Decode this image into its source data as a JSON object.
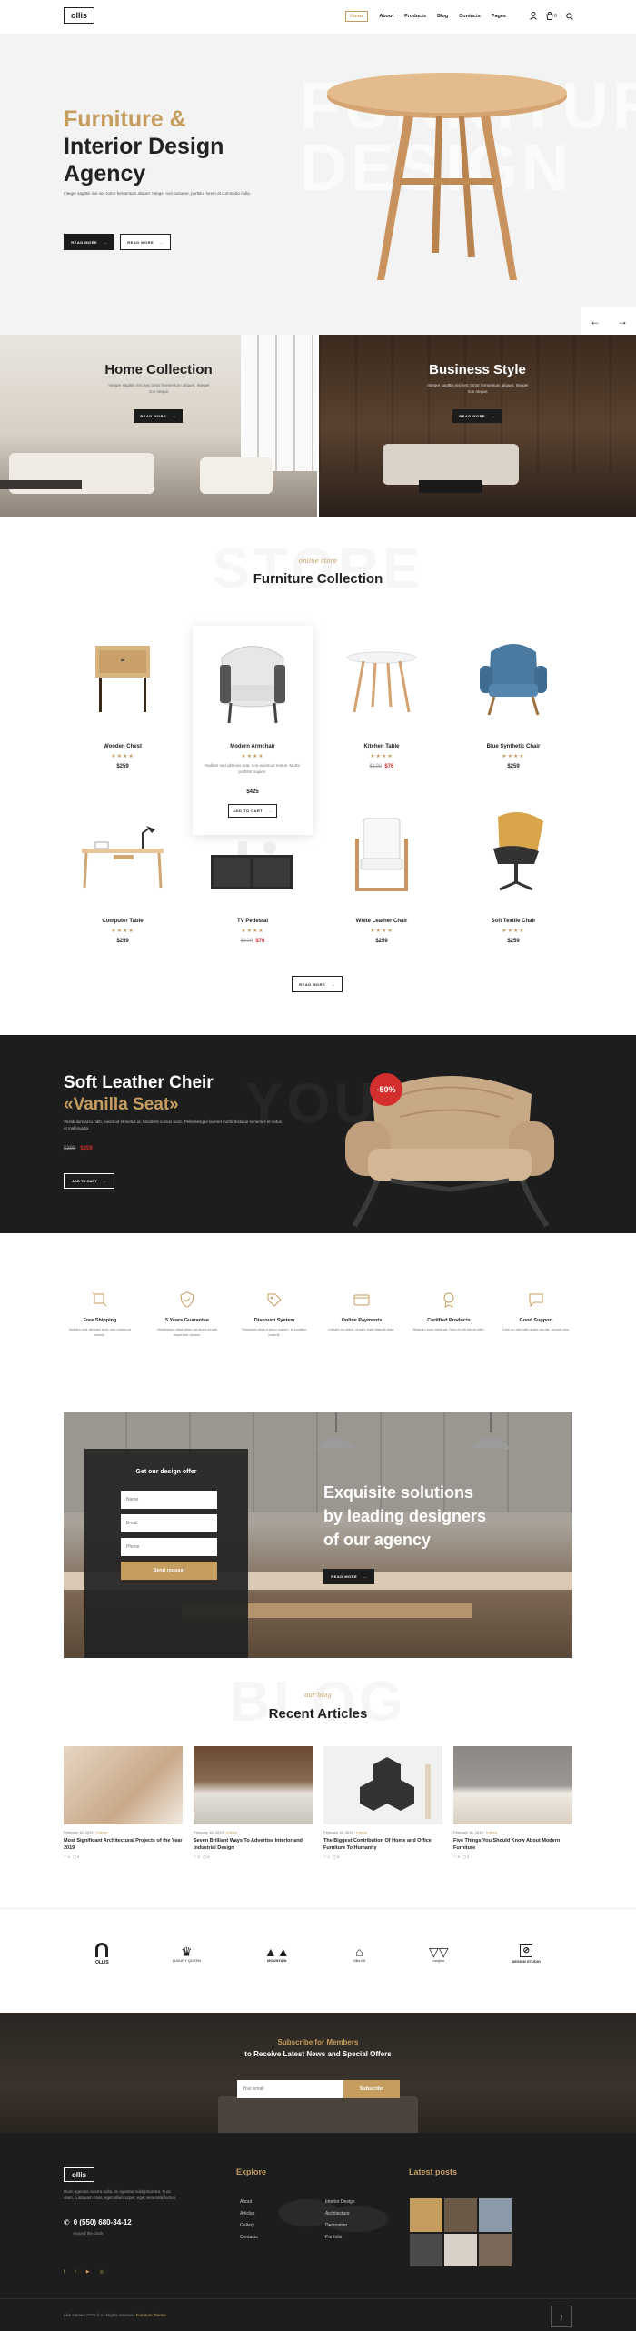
{
  "header": {
    "logo": "ollis",
    "nav": [
      "Home",
      "About",
      "Products",
      "Blog",
      "Contacts",
      "Pages"
    ],
    "cart_count": "0"
  },
  "hero": {
    "title_line1": "Furniture &",
    "title_line2": "Interior Design",
    "title_line3": "Agency",
    "bg_text_line1": "FURNITUR",
    "bg_text_line2": "DESIGN",
    "text": "Integer sagittis nisi nec tortor fermentum aliquet. Integer non posuere, porttitor lorem at commodo nulla.",
    "btn_primary": "READ MORE",
    "btn_secondary": "READ MORE"
  },
  "collections": [
    {
      "title": "Home Collection",
      "text": "Integer sagittis nisi nec tortor fermentum aliquet. Integer non neque.",
      "btn": "READ MORE"
    },
    {
      "title": "Business Style",
      "text": "Integer sagittis nisi nec tortor fermentum aliquet. Integer non neque.",
      "btn": "READ MORE"
    }
  ],
  "furniture": {
    "script": "online store",
    "bg_text": "STORE",
    "title": "Furniture Collection",
    "products": [
      {
        "name": "Wooden Chest",
        "old": "",
        "price": "$259"
      },
      {
        "name": "Modern Armchair",
        "old": "",
        "price": "$425",
        "desc": "Nullam sed ultricies erat, non euismod metus. Morbi porttitor sapien.",
        "btn": "ADD TO CART"
      },
      {
        "name": "Kitchen Table",
        "old": "$100",
        "price": "$76"
      },
      {
        "name": "Blue Synthetic Chair",
        "old": "",
        "price": "$259"
      },
      {
        "name": "Computer Table",
        "old": "",
        "price": "$259"
      },
      {
        "name": "TV Pedestal",
        "old": "$100",
        "price": "$76"
      },
      {
        "name": "White Leather Chair",
        "old": "",
        "price": "$259"
      },
      {
        "name": "Soft Textile Chair",
        "old": "",
        "price": "$259"
      }
    ],
    "more_btn": "READ MORE"
  },
  "promo": {
    "title": "Soft Leather Cheir",
    "subtitle": "«Vanilla Seat»",
    "bg_text": "YOU",
    "text": "Vestibulum arcu nibh, euismod et metus id, hendrerit cursus nunc. Pellentesque laoreet morbi tristique senectus et netus et malesuada.",
    "old": "$399",
    "price": "$259",
    "badge": "-50%",
    "btn": "ADD TO CART"
  },
  "features": [
    {
      "title": "Free Shipping",
      "text": "Nullam sed ultricies erat, nec euismod metus."
    },
    {
      "title": "5 Years Guarantee",
      "text": "Vestibulum vitae diam sit amet neque imperdiet ornare."
    },
    {
      "title": "Discount System",
      "text": "Praesent vitae rutrum sapien, id porttitor potenti."
    },
    {
      "title": "Online Payments",
      "text": "Integer ex diam, ornare eget blandit ante."
    },
    {
      "title": "Certified Products",
      "text": "Aliquam erat volutpat. Duis et elit lorem nibh."
    },
    {
      "title": "Good Support",
      "text": "Duis eu nisl odit quam iaculis, ornare nec."
    }
  ],
  "offer": {
    "form_title": "Get our design offer",
    "name_ph": "Name",
    "email_ph": "Email",
    "phone_ph": "Phone",
    "submit": "Send request",
    "headline1": "Exquisite solutions",
    "headline2": "by leading designers",
    "headline3": "of our agency",
    "btn": "READ MORE"
  },
  "articles": {
    "script": "our blog",
    "bg_text": "BLOG",
    "title": "Recent Articles",
    "items": [
      {
        "meta": "February 16, 2019",
        "cat": "Interior",
        "title": "Most Significant Architectural Projects of the Year 2019",
        "likes": "1",
        "comments": "0"
      },
      {
        "meta": "February 16, 2019",
        "cat": "Interior",
        "title": "Seven Brilliant Ways To Advertise Interior and Industrial Design",
        "likes": "0",
        "comments": "0"
      },
      {
        "meta": "February 16, 2019",
        "cat": "Interior",
        "title": "The Biggest Contribution Of Home and Office Furniture To Humanity",
        "likes": "1",
        "comments": "0"
      },
      {
        "meta": "February 16, 2019",
        "cat": "Interior",
        "title": "Five Things You Should Know About Modern Furniture",
        "likes": "0",
        "comments": "0"
      }
    ]
  },
  "brands": [
    "OLLIS",
    "LUXURY QUEEN",
    "MOUNTAIN",
    "Ollis Kit",
    "molybo",
    "DESIGN STUDIO"
  ],
  "subscribe": {
    "line1": "Subscribe for Members",
    "line2": "to Receive Latest News and Special Offers",
    "placeholder": "Your email",
    "btn": "Subscribe"
  },
  "footer": {
    "logo": "ollis",
    "about": "Diam egestas viverra nulla, mi egestas nulla pharetra. Fusc diam, a aliquam risus, eget ullamcorper, eget venenatis lectus.",
    "phone": "0 (550) 680-34-12",
    "hours": "Around the clock",
    "explore_title": "Explore",
    "explore_col1": [
      "About",
      "Articles",
      "Gallery",
      "Contacts"
    ],
    "explore_col2": [
      "Interior Design",
      "Architecture",
      "Decoration",
      "Portfolio"
    ],
    "posts_title": "Latest posts",
    "copyright": "Like Homes 2020 © All Rights reserved",
    "theme": "Furniture Theme"
  },
  "colors": {
    "accent": "#c59d5f",
    "dark": "#1d1d1d",
    "sale": "#d32f2f"
  }
}
